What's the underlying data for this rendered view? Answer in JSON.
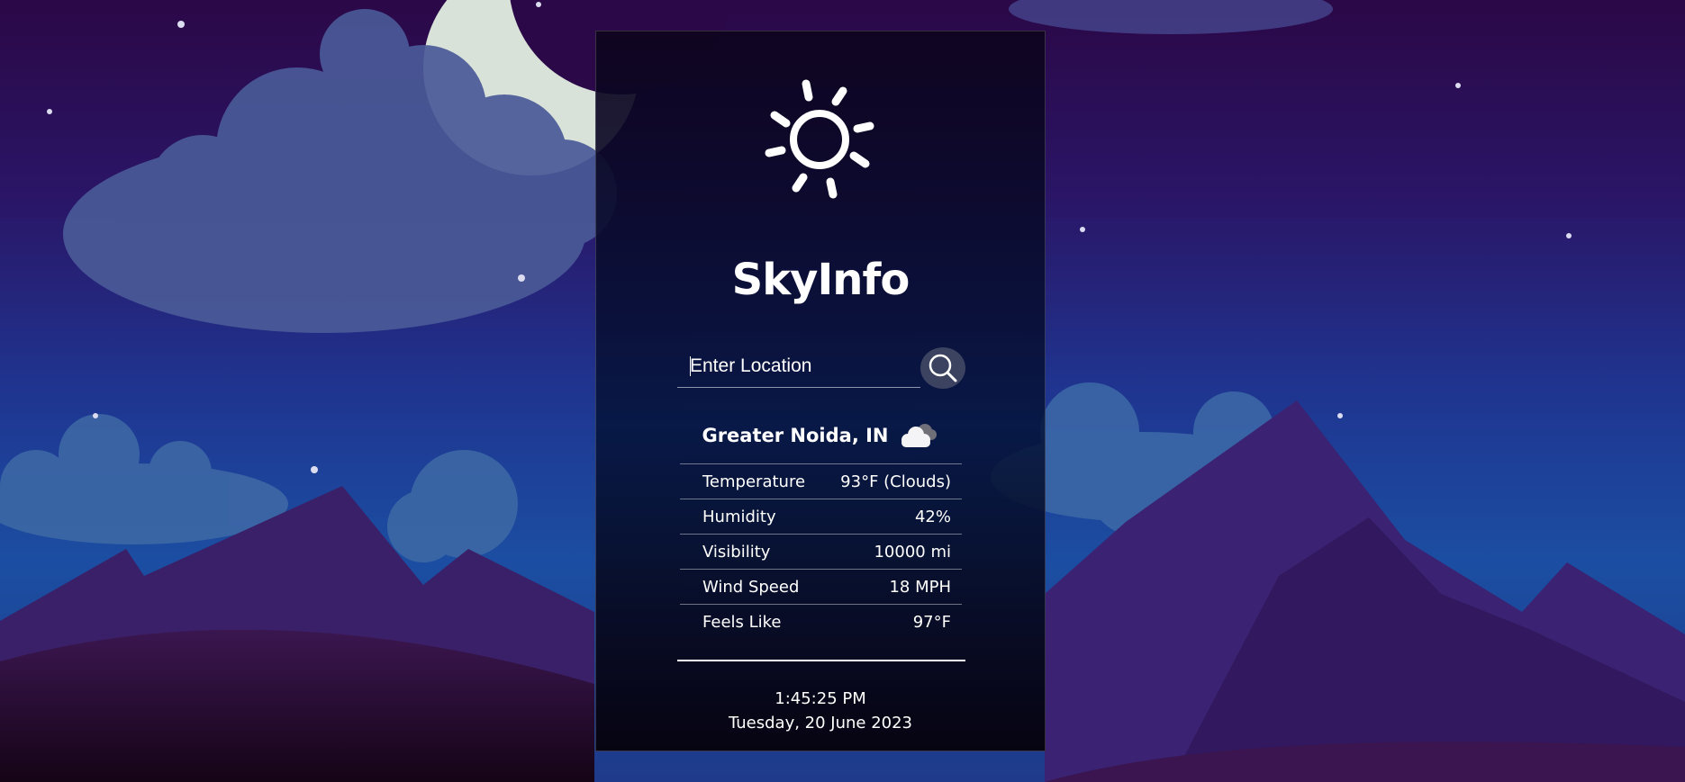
{
  "app": {
    "title": "SkyInfo",
    "logo_icon": "sun-icon"
  },
  "search": {
    "placeholder": "Enter Location",
    "button_icon": "search-icon"
  },
  "weather": {
    "location": "Greater Noida, IN",
    "condition_icon": "cloud-icon",
    "stats": [
      {
        "label": "Temperature",
        "value": "93°F (Clouds)"
      },
      {
        "label": "Humidity",
        "value": "42%"
      },
      {
        "label": "Visibility",
        "value": "10000 mi"
      },
      {
        "label": "Wind Speed",
        "value": "18 MPH"
      },
      {
        "label": "Feels Like",
        "value": "97°F"
      }
    ]
  },
  "clock": {
    "time": "1:45:25 PM",
    "date": "Tuesday, 20 June 2023"
  },
  "colors": {
    "sky_top": "#2a0a4a",
    "sky_bottom": "#1d4a9a",
    "mountain": "#3a2370",
    "card_bg": "#0b0a24",
    "search_button": "#3c4360",
    "text": "#ffffff"
  }
}
